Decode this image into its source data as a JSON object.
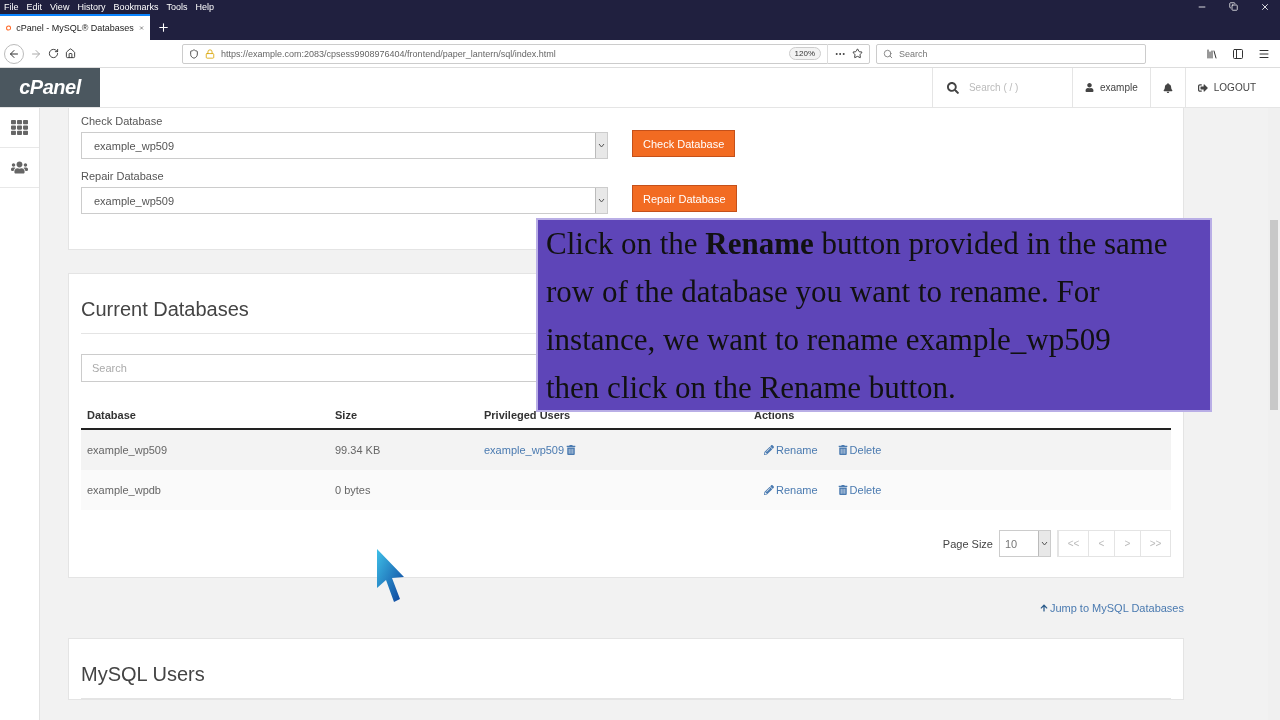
{
  "browser": {
    "menu": [
      "File",
      "Edit",
      "View",
      "History",
      "Bookmarks",
      "Tools",
      "Help"
    ],
    "tab": {
      "title": "cPanel - MySQL® Databases"
    },
    "url": "https://example.com:2083/cpsess9908976404/frontend/paper_lantern/sql/index.html",
    "zoom": "120%",
    "search": {
      "placeholder": "Search"
    }
  },
  "header": {
    "logo": "cPanel",
    "search": {
      "placeholder": "Search ( / )"
    },
    "user": "example",
    "logout": "LOGOUT"
  },
  "maintenance": [
    {
      "label": "Check Database",
      "value": "example_wp509",
      "button": "Check Database"
    },
    {
      "label": "Repair Database",
      "value": "example_wp509",
      "button": "Repair Database"
    }
  ],
  "current_databases": {
    "title": "Current Databases",
    "search": {
      "placeholder": "Search"
    },
    "columns": [
      "Database",
      "Size",
      "Privileged Users",
      "Actions"
    ],
    "rows": [
      {
        "database": "example_wp509",
        "size": "99.34 KB",
        "users": [
          "example_wp509"
        ],
        "actions": [
          "Rename",
          "Delete"
        ]
      },
      {
        "database": "example_wpdb",
        "size": "0 bytes",
        "actions": [
          "Rename",
          "Delete"
        ]
      }
    ],
    "pagination": {
      "label": "Page Size",
      "value": "10",
      "buttons": [
        "<<",
        "<",
        ">",
        ">>"
      ]
    }
  },
  "jump_link": "Jump to MySQL Databases",
  "mysql_users": {
    "title": "MySQL Users"
  },
  "caption_lines": [
    "Click on the **Rename** button provided in the same",
    "row of the database you want to rename. For",
    "instance, we want to rename example_wp509",
    "then click on the Rename button."
  ]
}
